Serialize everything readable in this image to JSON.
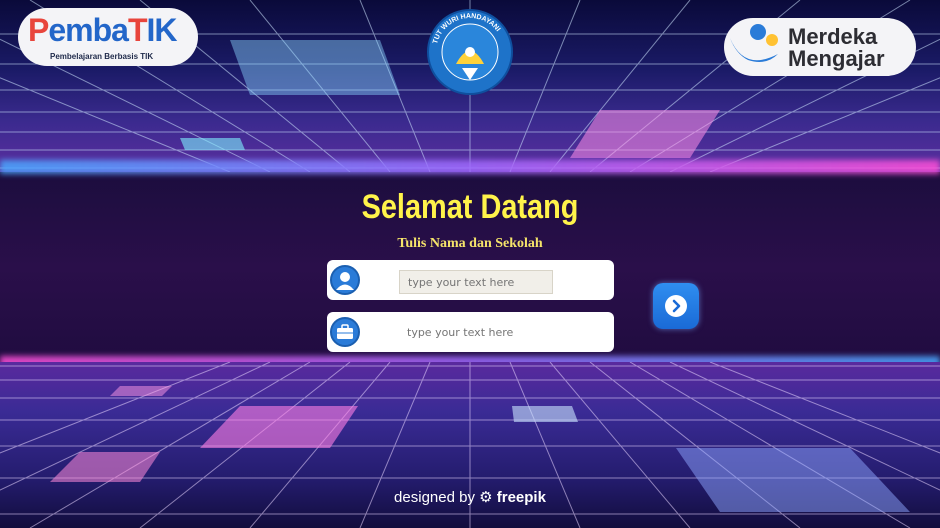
{
  "logos": {
    "pembatik_main": [
      "P",
      "emba",
      "T",
      "IK"
    ],
    "pembatik_sub": "Pembelajaran Berbasis TIK",
    "tutwuri_ring": "TUT WURI HANDAYANI",
    "merdeka_line1": "Merdeka",
    "merdeka_line2": "Mengajar"
  },
  "heading": {
    "title": "Selamat Datang",
    "subtitle": "Tulis Nama dan Sekolah"
  },
  "form": {
    "name_placeholder": "type your text here",
    "school_placeholder": "type your text here",
    "name_icon": "user-icon",
    "school_icon": "briefcase-icon",
    "next_icon": "chevron-right-icon"
  },
  "footer": {
    "designed_by": "designed by",
    "brand": "freepik"
  },
  "colors": {
    "title": "#fff34a",
    "button": "#1a6ad6"
  }
}
